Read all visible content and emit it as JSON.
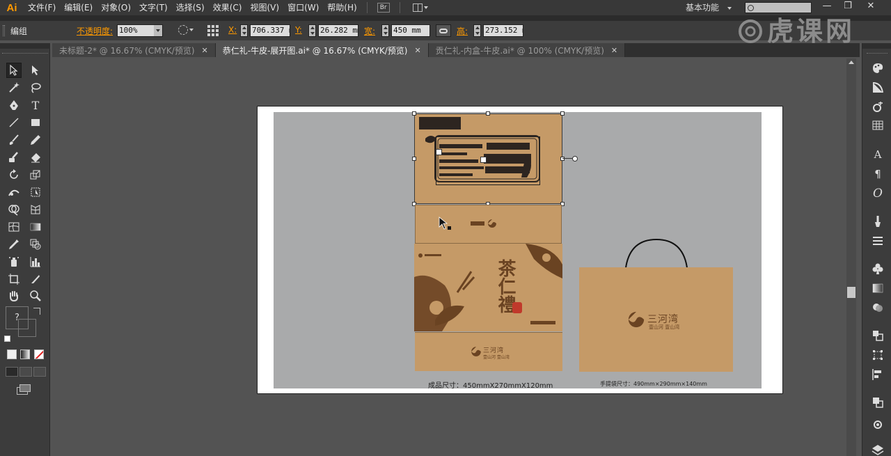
{
  "app": {
    "logo": "Ai",
    "menu": [
      "文件(F)",
      "编辑(E)",
      "对象(O)",
      "文字(T)",
      "选择(S)",
      "效果(C)",
      "视图(V)",
      "窗口(W)",
      "帮助(H)"
    ],
    "bridge_button": "Br",
    "workspace": "基本功能",
    "window_controls": {
      "minimize": "—",
      "restore": "❐",
      "close": "✕"
    }
  },
  "control_bar": {
    "selection_type": "编组",
    "opacity_label": "不透明度:",
    "opacity_value": "100%",
    "x_label": "X:",
    "x_value": "706.337 m",
    "y_label": "Y:",
    "y_value": "26.282 mm",
    "width_label": "宽:",
    "width_value": "450 mm",
    "height_label": "高:",
    "height_value": "273.152 m"
  },
  "tabs": [
    {
      "label": "未标题-2* @ 16.67% (CMYK/预览)",
      "close": "✕",
      "active": false
    },
    {
      "label": "恭仁礼-牛皮-展开图.ai* @ 16.67% (CMYK/预览)",
      "close": "✕",
      "active": true
    },
    {
      "label": "贡仁礼-内盒-牛皮.ai* @ 100% (CMYK/预览)",
      "close": "✕",
      "active": false
    }
  ],
  "tools": {
    "unknown_fill_label": "?"
  },
  "canvas": {
    "box_logo_text": "三河湾",
    "box_logo_sub": "壹山河  壹山湾",
    "bag_logo_text": "三河湾",
    "bag_logo_sub": "壹山河  壹山湾",
    "title_calligraphy": "茶仁禮",
    "box_size_label": "成品尺寸：450mmX270mmX120mm",
    "bag_size_label": "手提袋尺寸：490mm×290mm×140mm"
  },
  "watermark": "虎课网",
  "colors": {
    "kraft": "#c59a67",
    "ink": "#6a4322",
    "accent": "#ff9a00",
    "seal": "#c0392b"
  }
}
